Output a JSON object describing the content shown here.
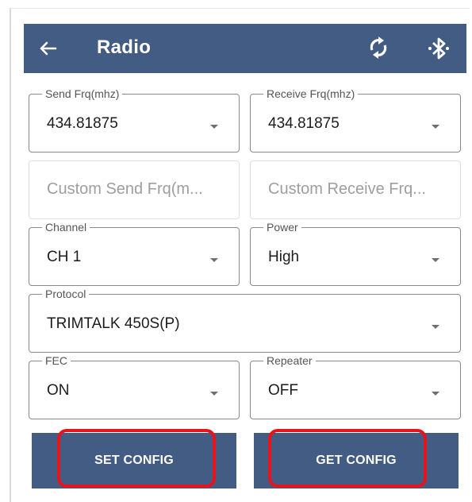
{
  "app_bar": {
    "title": "Radio",
    "back_icon": "arrow-left-icon",
    "sync_icon": "sync-icon",
    "bluetooth_icon": "bluetooth-icon"
  },
  "fields": {
    "send_frq": {
      "label": "Send Frq(mhz)",
      "value": "434.81875"
    },
    "receive_frq": {
      "label": "Receive Frq(mhz)",
      "value": "434.81875"
    },
    "custom_send": {
      "placeholder": "Custom Send Frq(m..."
    },
    "custom_receive": {
      "placeholder": "Custom Receive Frq..."
    },
    "channel": {
      "label": "Channel",
      "value": "CH 1"
    },
    "power": {
      "label": "Power",
      "value": "High"
    },
    "protocol": {
      "label": "Protocol",
      "value": "TRIMTALK 450S(P)"
    },
    "fec": {
      "label": "FEC",
      "value": "ON"
    },
    "repeater": {
      "label": "Repeater",
      "value": "OFF"
    }
  },
  "buttons": {
    "set_config": "SET CONFIG",
    "get_config": "GET CONFIG"
  },
  "colors": {
    "primary": "#425c84",
    "highlight": "#e8141b"
  }
}
